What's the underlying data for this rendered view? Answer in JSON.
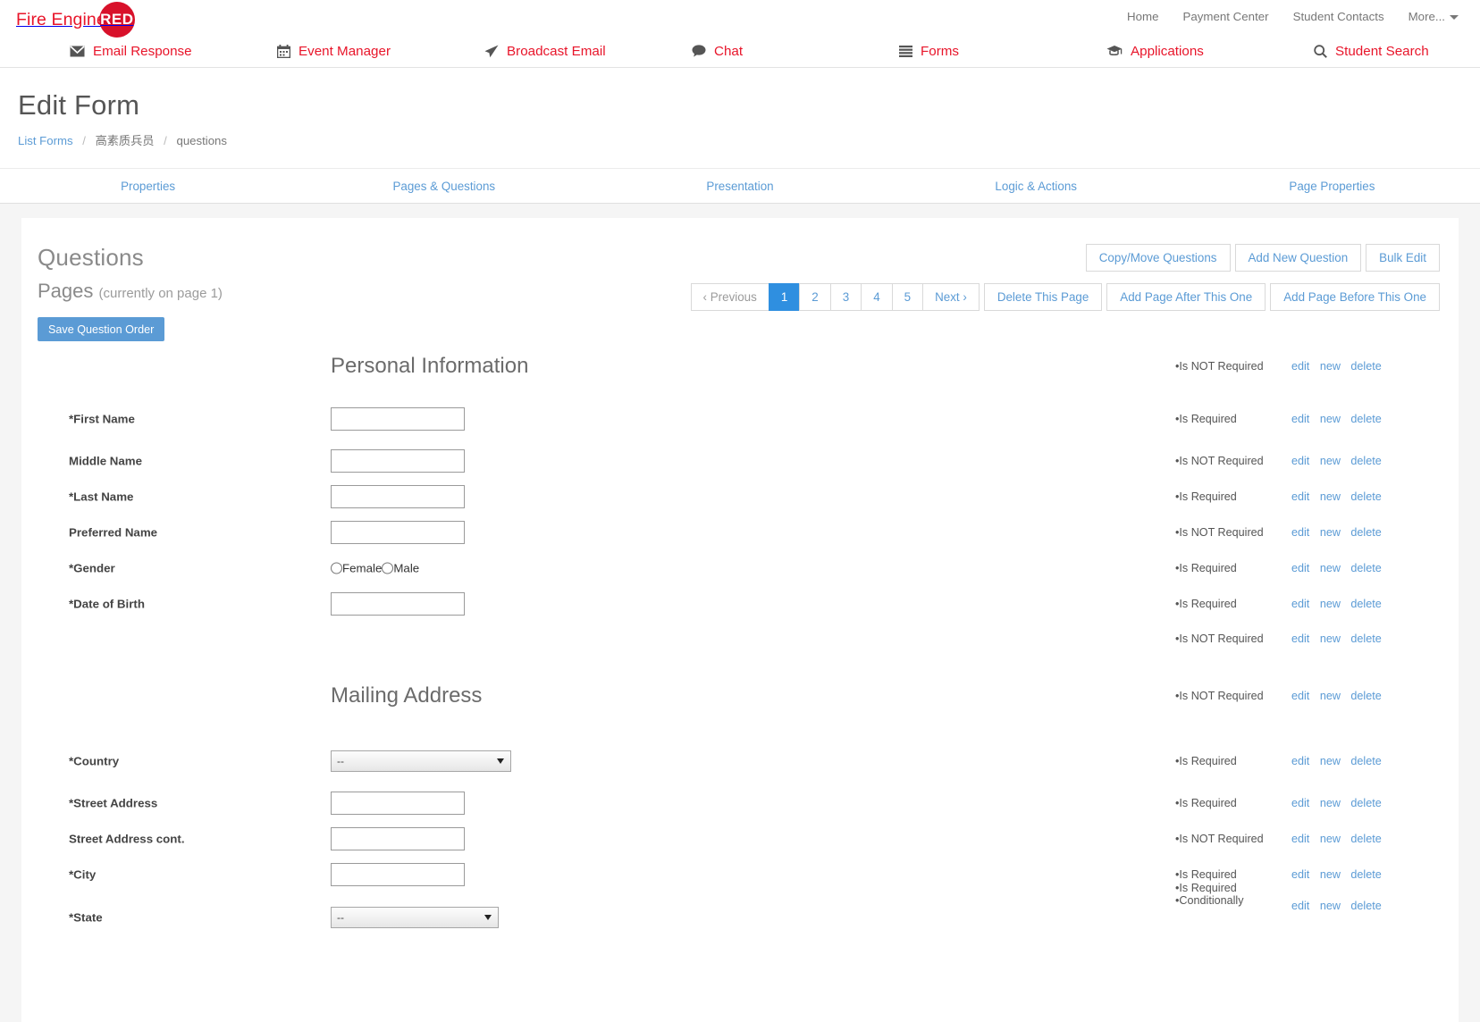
{
  "brand": {
    "text": "Fire Engine",
    "badge": "RED"
  },
  "utility_nav": [
    {
      "label": "Home",
      "icon": ""
    },
    {
      "label": "Payment Center",
      "icon": ""
    },
    {
      "label": "Student Contacts",
      "icon": ""
    },
    {
      "label": "More...",
      "icon": "chevron-down-icon"
    }
  ],
  "main_nav": [
    {
      "label": "Email Response",
      "icon": "envelope-icon"
    },
    {
      "label": "Event Manager",
      "icon": "calendar-icon"
    },
    {
      "label": "Broadcast Email",
      "icon": "paper-plane-icon"
    },
    {
      "label": "Chat",
      "icon": "comment-icon"
    },
    {
      "label": "Forms",
      "icon": "list-icon"
    },
    {
      "label": "Applications",
      "icon": "graduation-cap-icon"
    },
    {
      "label": "Student Search",
      "icon": "search-icon"
    }
  ],
  "page": {
    "title": "Edit Form",
    "breadcrumb": {
      "root": "List Forms",
      "form": "高素质兵员",
      "current": "questions",
      "separator": "/"
    }
  },
  "tabs": [
    {
      "label": "Properties"
    },
    {
      "label": "Pages & Questions"
    },
    {
      "label": "Presentation"
    },
    {
      "label": "Logic & Actions"
    },
    {
      "label": "Page Properties"
    }
  ],
  "card": {
    "section_title": "Questions",
    "pages_title": "Pages",
    "pages_note": "(currently on page 1)",
    "save_order_label": "Save Question Order",
    "top_buttons": [
      {
        "label": "Copy/Move Questions"
      },
      {
        "label": "Add New Question"
      },
      {
        "label": "Bulk Edit"
      }
    ],
    "pager": {
      "previous": "‹ Previous",
      "numbers": [
        "1",
        "2",
        "3",
        "4",
        "5"
      ],
      "active": "1",
      "next": "Next ›"
    },
    "page_buttons": [
      {
        "label": "Delete This Page"
      },
      {
        "label": "Add Page After This One"
      },
      {
        "label": "Add Page Before This One"
      }
    ]
  },
  "actions": {
    "edit": "edit",
    "new": "new",
    "delete": "delete"
  },
  "status": {
    "required": "•Is Required",
    "not_required": "•Is NOT Required",
    "conditionally": "•Conditionally"
  },
  "rows": [
    {
      "type": "section",
      "section": "Personal Information",
      "status": "not_required",
      "acts": true
    },
    {
      "type": "text",
      "label": "*First Name",
      "status": "required",
      "acts": true
    },
    {
      "type": "text",
      "label": "Middle Name",
      "status": "not_required",
      "acts": true
    },
    {
      "type": "text",
      "label": "*Last Name",
      "status": "required",
      "acts": true
    },
    {
      "type": "text",
      "label": "Preferred Name",
      "status": "not_required",
      "acts": true
    },
    {
      "type": "radio",
      "label": "*Gender",
      "options": [
        "Female",
        "Male"
      ],
      "status": "required",
      "acts": true
    },
    {
      "type": "text",
      "label": "*Date of Birth",
      "status": "required",
      "acts": true
    },
    {
      "type": "blank",
      "status": "not_required",
      "acts": true
    },
    {
      "type": "section",
      "section": "Mailing Address",
      "status": "not_required",
      "acts": true
    },
    {
      "type": "select",
      "label": "*Country",
      "value": "--",
      "status": "required",
      "acts": true
    },
    {
      "type": "text",
      "label": "*Street Address",
      "status": "required",
      "acts": true
    },
    {
      "type": "text",
      "label": "Street Address cont.",
      "status": "not_required",
      "acts": true
    },
    {
      "type": "text",
      "label": "*City",
      "status": "required",
      "acts": true
    },
    {
      "type": "select2",
      "label": "*State",
      "value": "--",
      "status": "required_conditionally",
      "acts": true
    }
  ]
}
